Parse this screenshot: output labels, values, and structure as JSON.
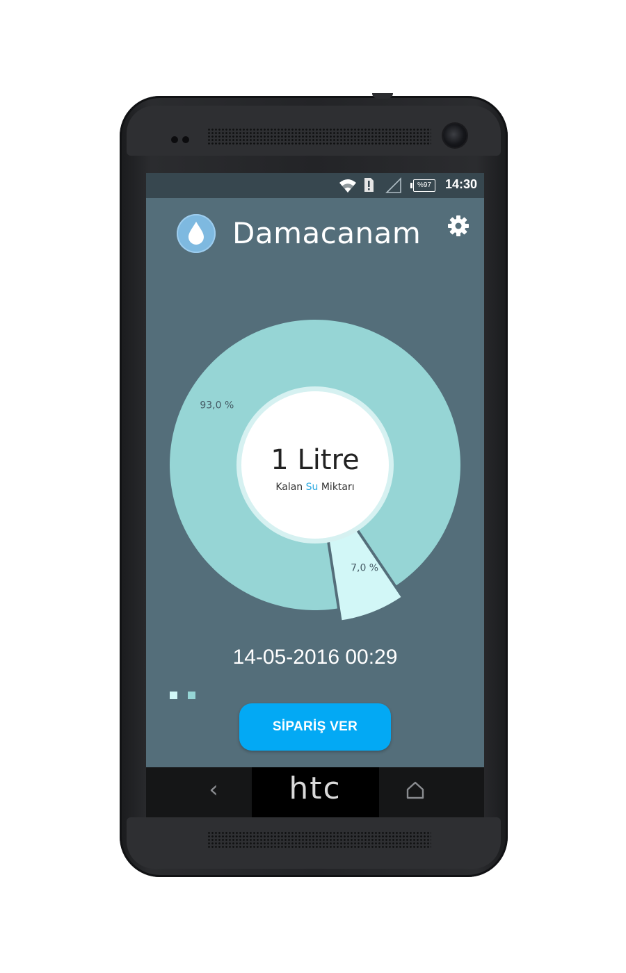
{
  "device": {
    "brand_logo": "htc",
    "nav": {
      "back_icon": "back-chevron-icon",
      "home_icon": "home-icon"
    }
  },
  "status_bar": {
    "time": "14:30",
    "battery": "%97",
    "icons": [
      "wifi-icon",
      "sim-alert-icon",
      "signal-icon",
      "battery-icon"
    ]
  },
  "app": {
    "title": "Damacanam",
    "logo_icon": "water-drop-icon",
    "settings_icon": "gear-icon"
  },
  "center": {
    "amount": "1 Litre",
    "caption_prefix": "Kalan ",
    "caption_highlight": "Su",
    "caption_suffix": " Miktarı"
  },
  "timestamp": "14-05-2016 00:29",
  "pager": {
    "count": 2,
    "active": 0
  },
  "order_button": {
    "label": "SİPARİŞ VER"
  },
  "colors": {
    "background": "#546e7a",
    "status_bar": "#37474f",
    "slice_main": "#96d5d5",
    "slice_small": "#d2f7f7",
    "accent": "#03a9f4",
    "highlight_text": "#29a8e0"
  },
  "chart_data": {
    "type": "pie",
    "categories": [
      "93,0 %",
      "7,0 %"
    ],
    "values": [
      93.0,
      7.0
    ],
    "labels": [
      "93,0 %",
      "7,0 %"
    ],
    "title": "",
    "donut": true
  }
}
